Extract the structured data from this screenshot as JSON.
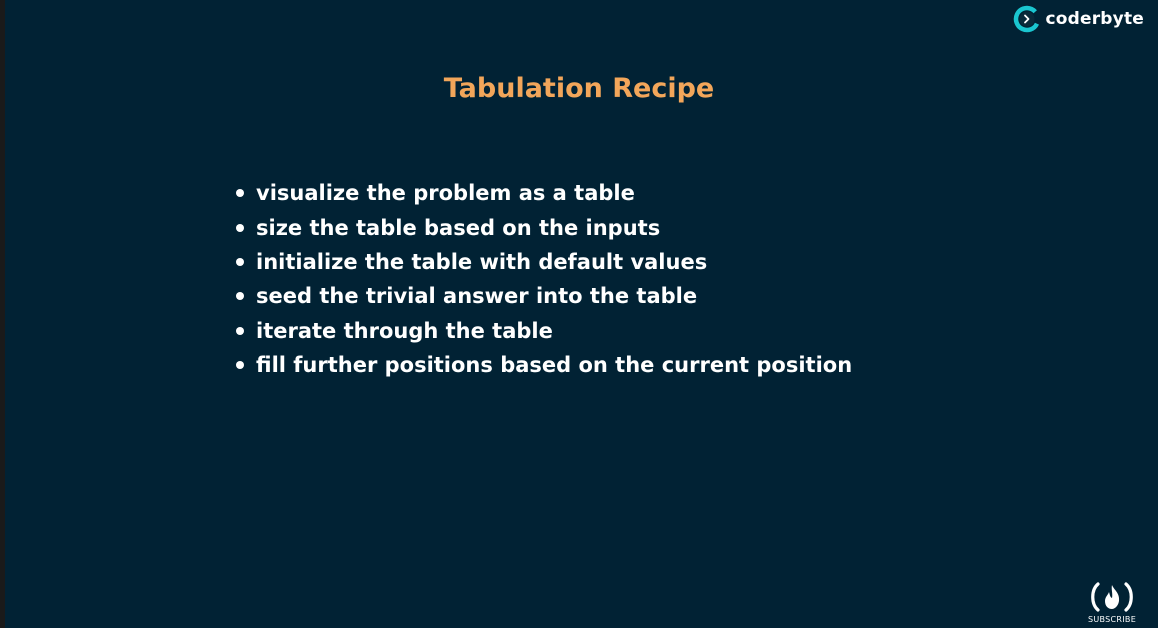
{
  "brand": {
    "name": "coderbyte",
    "logo_icon": "coderbyte-logo-icon"
  },
  "slide": {
    "title": "Tabulation Recipe",
    "bullets": [
      "visualize the problem as a table",
      "size the table based on the inputs",
      "initialize the table with default values",
      "seed the trivial answer into the table",
      "iterate through the table",
      "fill further positions based on the current position"
    ]
  },
  "subscribe": {
    "label": "SUBSCRIBE",
    "icon": "freecodecamp-fire-icon"
  },
  "colors": {
    "background": "#012234",
    "title": "#f2a65a",
    "text": "#ffffff",
    "brand_accent": "#1ac6d0"
  }
}
